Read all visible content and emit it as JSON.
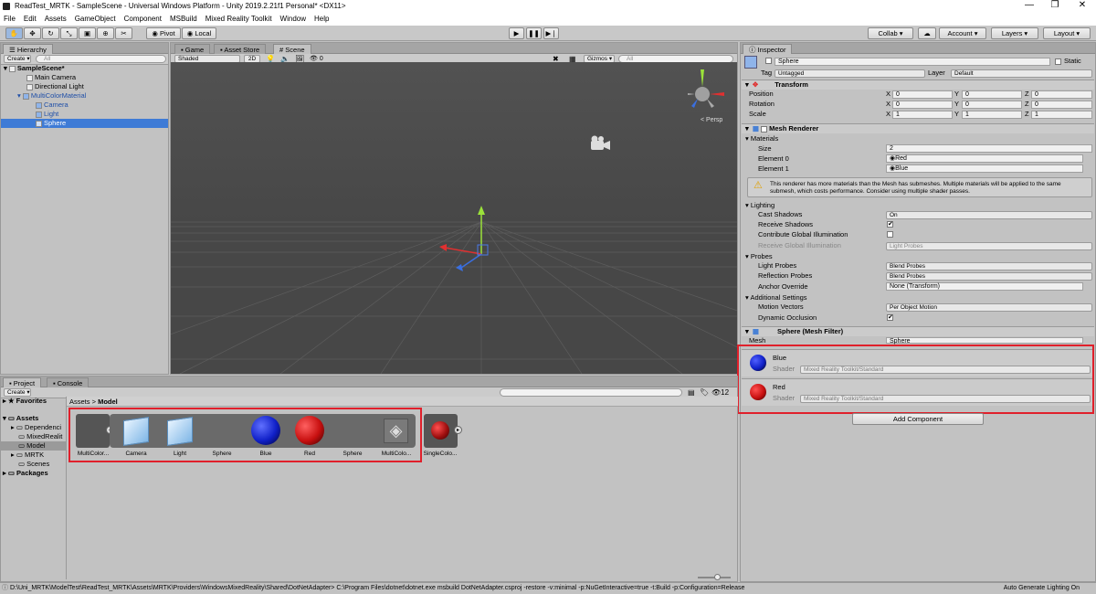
{
  "window": {
    "title": "ReadTest_MRTK - SampleScene - Universal Windows Platform - Unity 2019.2.21f1 Personal* <DX11>",
    "min": "—",
    "max": "❐",
    "close": "✕"
  },
  "menu": [
    "File",
    "Edit",
    "Assets",
    "GameObject",
    "Component",
    "MSBuild",
    "Mixed Reality Toolkit",
    "Window",
    "Help"
  ],
  "toolbar": {
    "pivot": "Pivot",
    "local": "Local",
    "collab": "Collab ▾",
    "account": "Account ▾",
    "layers": "Layers ▾",
    "layout": "Layout ▾"
  },
  "hierarchy": {
    "tab": "Hierarchy",
    "create": "Create ▾",
    "search": "All",
    "rows": [
      "SampleScene*",
      "Main Camera",
      "Directional Light",
      "MultiColorMaterial",
      "Camera",
      "Light",
      "Sphere"
    ]
  },
  "scene": {
    "tabs": [
      "Game",
      "Asset Store",
      "Scene"
    ],
    "shaded": "Shaded",
    "mode2d": "2D",
    "gizmos": "Gizmos ▾",
    "search": "All",
    "persp": "< Persp",
    "zero": "0"
  },
  "inspector": {
    "tab": "Inspector",
    "name": "Sphere",
    "static": "Static",
    "tag_label": "Tag",
    "tag": "Untagged",
    "layer_label": "Layer",
    "layer": "Default",
    "transform": {
      "title": "Transform",
      "rows": [
        {
          "label": "Position",
          "x": "0",
          "y": "0",
          "z": "0"
        },
        {
          "label": "Rotation",
          "x": "0",
          "y": "0",
          "z": "0"
        },
        {
          "label": "Scale",
          "x": "1",
          "y": "1",
          "z": "1"
        }
      ]
    },
    "mesh_renderer": {
      "title": "Mesh Renderer",
      "materials": "Materials",
      "size_label": "Size",
      "size": "2",
      "el0_label": "Element 0",
      "el0": "Red",
      "el1_label": "Element 1",
      "el1": "Blue",
      "warning": "This renderer has more materials than the Mesh has submeshes. Multiple materials will be applied to the same submesh, which costs performance. Consider using multiple shader passes.",
      "lighting": "Lighting",
      "cast_label": "Cast Shadows",
      "cast": "On",
      "receive_label": "Receive Shadows",
      "contrib_label": "Contribute Global Illumination",
      "recv_gi_label": "Receive Global Illumination",
      "recv_gi": "Light Probes",
      "probes": "Probes",
      "lp_label": "Light Probes",
      "lp": "Blend Probes",
      "rp_label": "Reflection Probes",
      "rp": "Blend Probes",
      "anchor_label": "Anchor Override",
      "anchor": "None (Transform)",
      "additional": "Additional Settings",
      "mv_label": "Motion Vectors",
      "mv": "Per Object Motion",
      "dyn_label": "Dynamic Occlusion"
    },
    "mesh_filter": {
      "title": "Sphere (Mesh Filter)",
      "mesh_label": "Mesh",
      "mesh": "Sphere"
    },
    "materials": [
      {
        "name": "Blue",
        "shader_label": "Shader",
        "shader": "Mixed Reality Toolkit/Standard",
        "color": "#1020c8"
      },
      {
        "name": "Red",
        "shader_label": "Shader",
        "shader": "Mixed Reality Toolkit/Standard",
        "color": "#c81010"
      }
    ],
    "add_component": "Add Component"
  },
  "project": {
    "tabs": [
      "Project",
      "Console"
    ],
    "create": "Create ▾",
    "favorites": "Favorites",
    "tree": [
      "Assets",
      "Dependenci",
      "MixedRealit",
      "Model",
      "MRTK",
      "Scenes",
      "Packages"
    ],
    "breadcrumb_root": "Assets",
    "breadcrumb_sep": ">",
    "breadcrumb_current": "Model",
    "count": "12",
    "assets": [
      {
        "label": "MultiColor..."
      },
      {
        "label": "Camera"
      },
      {
        "label": "Light"
      },
      {
        "label": "Sphere"
      },
      {
        "label": "Blue"
      },
      {
        "label": "Red"
      },
      {
        "label": "Sphere"
      },
      {
        "label": "MultiColo..."
      },
      {
        "label": "SingleColo..."
      }
    ]
  },
  "status": {
    "message": "D:\\Uni_MRTK\\ModelTest\\ReadTest_MRTK\\Assets\\MRTK\\Providers\\WindowsMixedReality\\Shared\\DotNetAdapter> C:\\Program Files\\dotnet\\dotnet.exe msbuild DotNetAdapter.csproj -restore  -v:minimal -p:NuGetInteractive=true  -t:Build -p:Configuration=Release",
    "right": "Auto Generate Lighting On"
  },
  "colors": {
    "highlight": "#3e7bd6",
    "annotation": "#e0202b",
    "scene_bg": "#474747"
  }
}
